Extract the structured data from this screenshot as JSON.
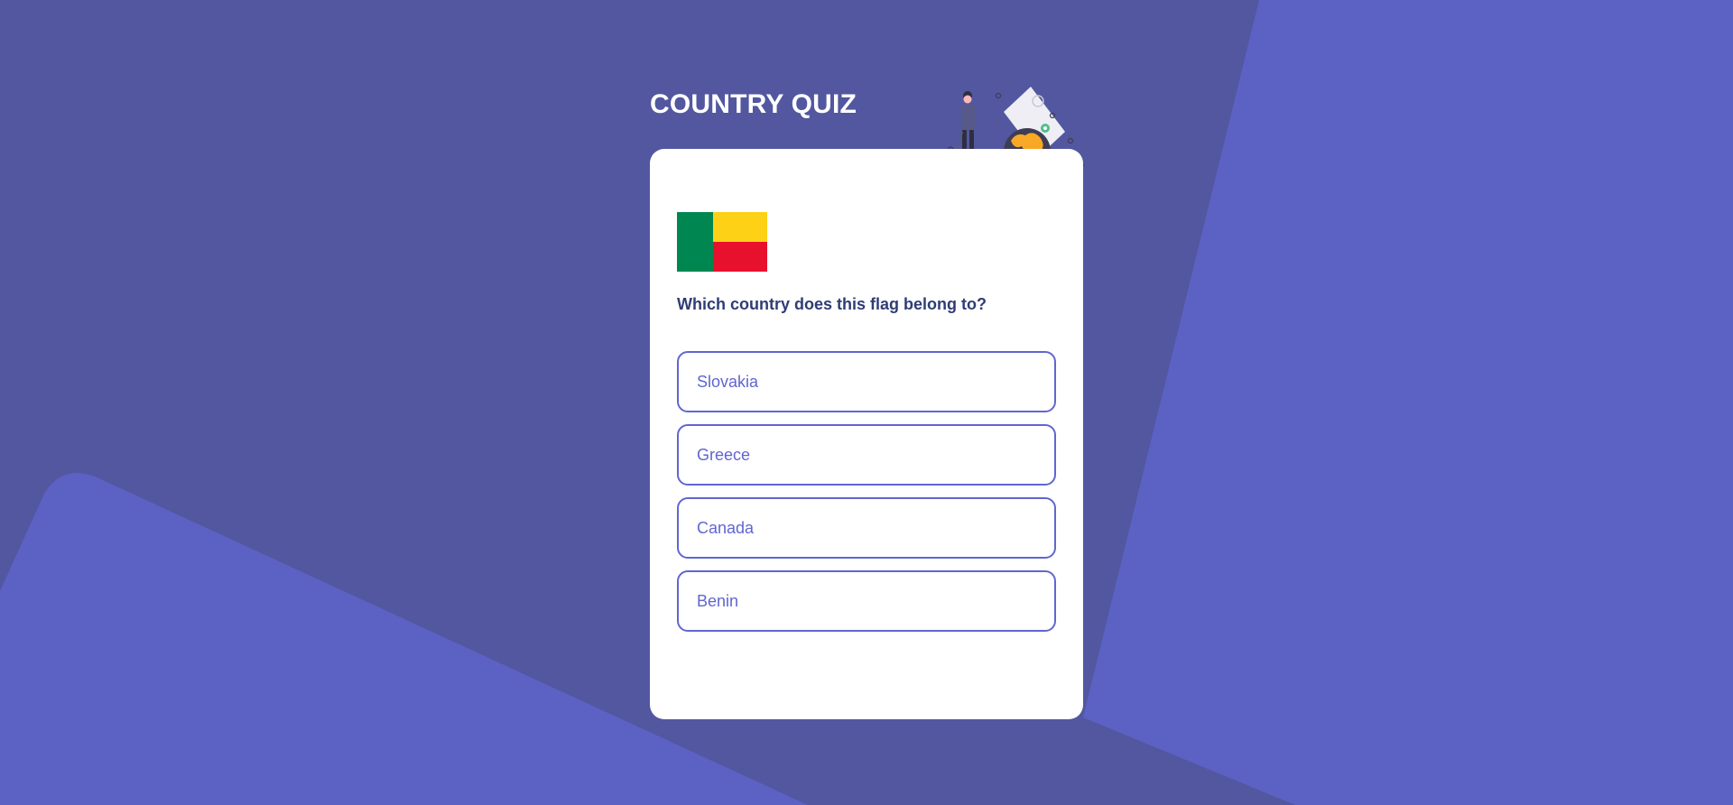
{
  "colors": {
    "background": "#5257a0",
    "accent_shape": "#5c62c4",
    "card": "#ffffff",
    "question_text": "#2f3d74",
    "answer_border": "#6066d0",
    "flag_green": "#008751",
    "flag_yellow": "#fcd116",
    "flag_red": "#e8112d"
  },
  "app": {
    "title": "COUNTRY QUIZ"
  },
  "quiz": {
    "flag_icon": "benin-flag-icon",
    "illustration_icon": "traveler-globe-illustration",
    "question": "Which country does this flag belong to?",
    "answers": [
      {
        "label": "Slovakia"
      },
      {
        "label": "Greece"
      },
      {
        "label": "Canada"
      },
      {
        "label": "Benin"
      }
    ]
  }
}
